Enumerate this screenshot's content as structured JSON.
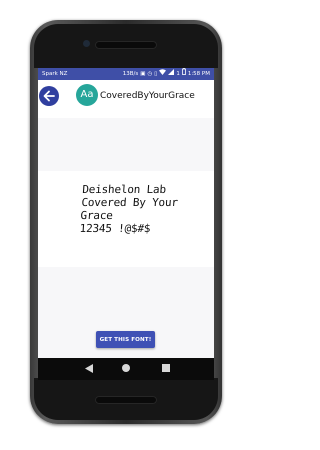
{
  "status_bar": {
    "carrier": "Spark NZ",
    "speed": "13B/s",
    "battery_percent": "1",
    "time": "1:58 PM"
  },
  "app_bar": {
    "back_icon": "arrow-left-icon",
    "avatar_text": "Aa",
    "font_name": "CoveredByYourGrace"
  },
  "preview": {
    "lines": [
      "Deishelon Lab",
      "Covered By Your",
      "Grace",
      "12345 !@$#$"
    ]
  },
  "actions": {
    "get_font_label": "GET THIS FONT!"
  },
  "colors": {
    "status_bar": "#3f4fa7",
    "back_button": "#303f9f",
    "avatar": "#26a69a",
    "primary_button": "#3f51b5"
  }
}
